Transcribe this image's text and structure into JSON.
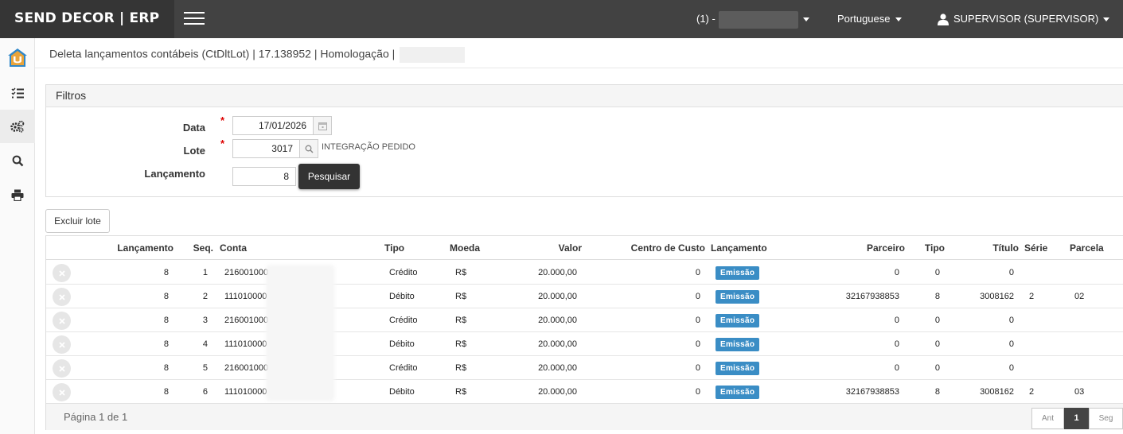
{
  "brand": "SEND DECOR | ERP",
  "topbar": {
    "company_label": "(1) -",
    "language": "Portuguese",
    "user": "SUPERVISOR (SUPERVISOR)"
  },
  "breadcrumb": "Deleta lançamentos contábeis (CtDltLot) | 17.138952 | Homologação |",
  "filters": {
    "title": "Filtros",
    "data_label": "Data",
    "data_value": "17/01/2026",
    "lote_label": "Lote",
    "lote_value": "3017",
    "lote_desc": "INTEGRAÇÃO PEDIDO",
    "lancamento_label": "Lançamento",
    "lancamento_value": "8",
    "search_label": "Pesquisar",
    "required_mark": "*"
  },
  "actions": {
    "excluir_lote": "Excluir lote"
  },
  "table": {
    "headers": {
      "lancamento": "Lançamento",
      "seq": "Seq.",
      "conta": "Conta",
      "tipo": "Tipo",
      "moeda": "Moeda",
      "valor": "Valor",
      "centro": "Centro de Custo",
      "lanc2": "Lançamento",
      "parceiro": "Parceiro",
      "tipo2": "Tipo",
      "titulo": "Título",
      "serie": "Série",
      "parcela": "Parcela"
    },
    "rows": [
      {
        "lancamento": "8",
        "seq": "1",
        "conta": "216001000",
        "tipo": "Crédito",
        "moeda": "R$",
        "valor": "20.000,00",
        "centro": "0",
        "lanc2": "Emissão",
        "parceiro": "0",
        "tipo2": "0",
        "titulo": "0",
        "serie": "",
        "parcela": ""
      },
      {
        "lancamento": "8",
        "seq": "2",
        "conta": "111010000",
        "tipo": "Débito",
        "moeda": "R$",
        "valor": "20.000,00",
        "centro": "0",
        "lanc2": "Emissão",
        "parceiro": "32167938853",
        "tipo2": "8",
        "titulo": "3008162",
        "serie": "2",
        "parcela": "02"
      },
      {
        "lancamento": "8",
        "seq": "3",
        "conta": "216001000",
        "tipo": "Crédito",
        "moeda": "R$",
        "valor": "20.000,00",
        "centro": "0",
        "lanc2": "Emissão",
        "parceiro": "0",
        "tipo2": "0",
        "titulo": "0",
        "serie": "",
        "parcela": ""
      },
      {
        "lancamento": "8",
        "seq": "4",
        "conta": "111010000",
        "tipo": "Débito",
        "moeda": "R$",
        "valor": "20.000,00",
        "centro": "0",
        "lanc2": "Emissão",
        "parceiro": "0",
        "tipo2": "0",
        "titulo": "0",
        "serie": "",
        "parcela": ""
      },
      {
        "lancamento": "8",
        "seq": "5",
        "conta": "216001000",
        "tipo": "Crédito",
        "moeda": "R$",
        "valor": "20.000,00",
        "centro": "0",
        "lanc2": "Emissão",
        "parceiro": "0",
        "tipo2": "0",
        "titulo": "0",
        "serie": "",
        "parcela": ""
      },
      {
        "lancamento": "8",
        "seq": "6",
        "conta": "111010000",
        "tipo": "Débito",
        "moeda": "R$",
        "valor": "20.000,00",
        "centro": "0",
        "lanc2": "Emissão",
        "parceiro": "32167938853",
        "tipo2": "8",
        "titulo": "3008162",
        "serie": "2",
        "parcela": "03"
      }
    ]
  },
  "pagination": {
    "info": "Página 1 de 1",
    "prev": "Ant",
    "current": "1",
    "next": "Seg"
  },
  "colors": {
    "topbar": "#424242",
    "brand_bg": "#353535",
    "badge": "#3a8dc5",
    "required": "#dd0000"
  },
  "icons": {
    "sidebar": [
      "app-logo-icon",
      "list-icon",
      "gears-icon",
      "search-icon",
      "print-icon"
    ],
    "calendar": "calendar-icon",
    "lookup": "search-icon",
    "row_delete": "close-circle-icon"
  }
}
